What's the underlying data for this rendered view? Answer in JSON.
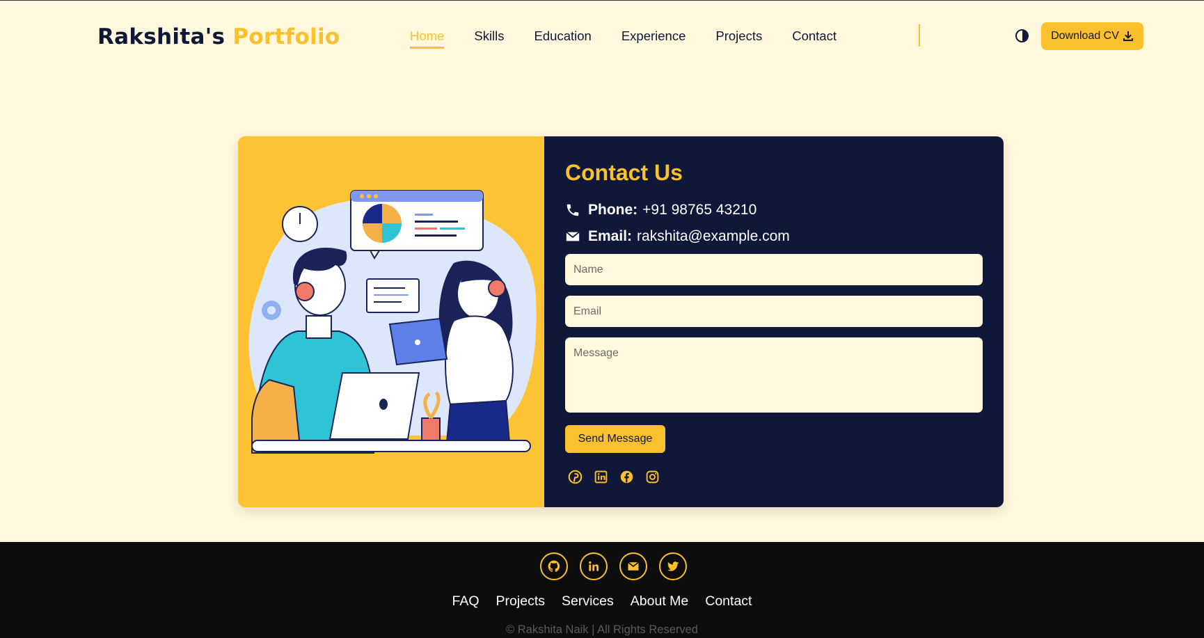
{
  "header": {
    "logo_name": "Rakshita's",
    "logo_accent": "Portfolio",
    "nav": [
      "Home",
      "Skills",
      "Education",
      "Experience",
      "Projects",
      "Contact"
    ],
    "active_nav": "Home",
    "download_label": "Download CV",
    "download_icon": "download-icon",
    "theme_icon": "contrast-icon"
  },
  "contact": {
    "title": "Contact Us",
    "phone_label": "Phone:",
    "phone_value": "+91 98765 43210",
    "email_label": "Email:",
    "email_value": "rakshita@example.com",
    "name_placeholder": "Name",
    "email_placeholder": "Email",
    "message_placeholder": "Message",
    "send_label": "Send Message",
    "social_icons": [
      "pinterest-icon",
      "linkedin-icon",
      "facebook-icon",
      "instagram-icon"
    ]
  },
  "footer": {
    "social_icons": [
      "github-icon",
      "linkedin-icon",
      "email-icon",
      "twitter-icon"
    ],
    "links": [
      "FAQ",
      "Projects",
      "Services",
      "About Me",
      "Contact"
    ],
    "copyright": "© Rakshita Naik | All Rights Reserved"
  },
  "colors": {
    "accent": "#fbc02d",
    "navy": "#0f1838",
    "background": "#fff8dc",
    "footer": "#0d0d0d"
  }
}
